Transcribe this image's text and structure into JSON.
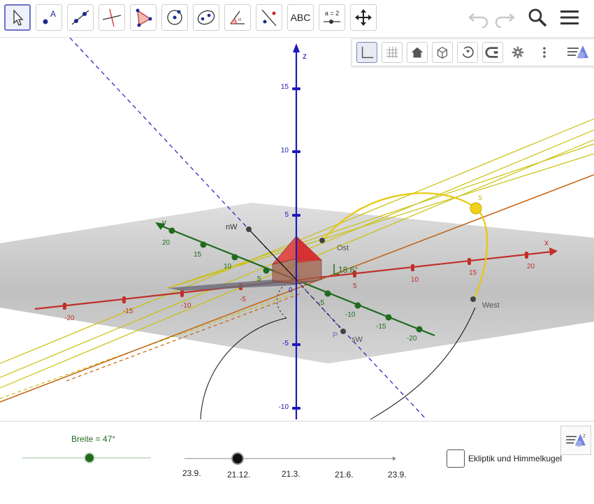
{
  "toolbar": {
    "tools": [
      {
        "name": "move-tool-icon"
      },
      {
        "name": "point-tool-icon",
        "letter": "A"
      },
      {
        "name": "line-tool-icon"
      },
      {
        "name": "perpendicular-tool-icon"
      },
      {
        "name": "polygon-tool-icon"
      },
      {
        "name": "circle-tool-icon"
      },
      {
        "name": "ellipse-tool-icon"
      },
      {
        "name": "angle-tool-icon"
      },
      {
        "name": "reflect-tool-icon"
      },
      {
        "name": "text-tool",
        "label": "ABC"
      },
      {
        "name": "slider-tool",
        "label": "a = 2"
      },
      {
        "name": "move-view-tool-icon"
      }
    ],
    "right": [
      "undo-icon",
      "redo-icon",
      "search-icon",
      "menu-icon"
    ]
  },
  "style_bar": {
    "buttons": [
      "axes-icon",
      "grid-icon",
      "home-icon",
      "view-cube-icon",
      "rotate-icon",
      "projection-icon",
      "gear-icon",
      "more-icon",
      "algebra-style-icon"
    ]
  },
  "graphics": {
    "axis_labels": {
      "x": "x",
      "y": "y",
      "z": "z"
    },
    "z_ticks": [
      "15",
      "10",
      "5",
      "-5",
      "-10"
    ],
    "x_ticks": [
      "-20",
      "-15",
      "-10",
      "-5",
      "0",
      "5",
      "10",
      "15",
      "20"
    ],
    "y_ticks": [
      "20",
      "15",
      "10",
      "5",
      "0",
      "-5",
      "-10",
      "-15",
      "-20"
    ],
    "points": {
      "nw": "nW",
      "ost": "Ost",
      "west": "West",
      "sw": "sW",
      "p": "P",
      "s": "S"
    },
    "angle_label": "18.6°"
  },
  "bottom": {
    "latitude_label": "Breite = 47°",
    "latitude_value": 47,
    "date_labels": [
      "23.9.",
      "21.12.",
      "21.3.",
      "21.6.",
      "23.9."
    ],
    "checkbox_label": "Ekliptik und Himmelkugel",
    "checkbox_checked": false
  },
  "colors": {
    "accent": "#6b74c9",
    "x_axis": "#c0302a",
    "y_axis": "#1f6b1f",
    "z_axis": "#1c1ab8",
    "sun": "#f2d21a",
    "house": "#e23a3a"
  }
}
